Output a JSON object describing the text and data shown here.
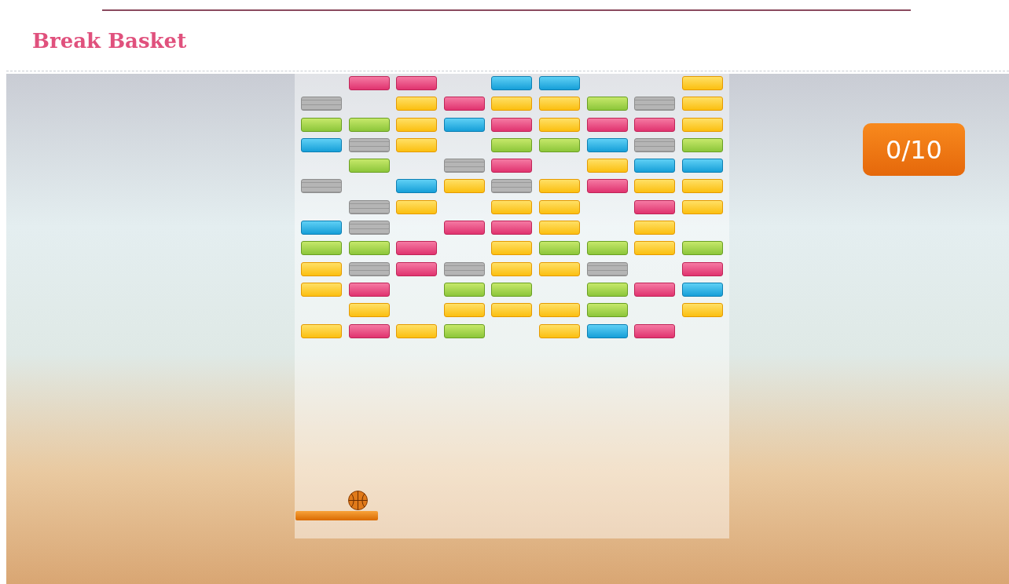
{
  "header": {
    "title": "Break Basket"
  },
  "game": {
    "score": "0/10",
    "brick_rows": [
      {
        "bricks": [
          {
            "kind": "empty"
          },
          {
            "kind": "pink"
          },
          {
            "kind": "pink"
          },
          {
            "kind": "empty"
          },
          {
            "kind": "blue"
          },
          {
            "kind": "blue"
          },
          {
            "kind": "empty"
          },
          {
            "kind": "empty"
          },
          {
            "kind": "yellow"
          }
        ]
      },
      {
        "bricks": [
          {
            "kind": "stone"
          },
          {
            "kind": "empty"
          },
          {
            "kind": "yellow"
          },
          {
            "kind": "pink"
          },
          {
            "kind": "yellow"
          },
          {
            "kind": "yellow"
          },
          {
            "kind": "green"
          },
          {
            "kind": "stone"
          },
          {
            "kind": "yellow"
          }
        ]
      },
      {
        "bricks": [
          {
            "kind": "green"
          },
          {
            "kind": "green"
          },
          {
            "kind": "yellow"
          },
          {
            "kind": "blue"
          },
          {
            "kind": "pink"
          },
          {
            "kind": "yellow"
          },
          {
            "kind": "pink"
          },
          {
            "kind": "pink"
          },
          {
            "kind": "yellow"
          }
        ]
      },
      {
        "bricks": [
          {
            "kind": "blue"
          },
          {
            "kind": "stone"
          },
          {
            "kind": "yellow"
          },
          {
            "kind": "empty"
          },
          {
            "kind": "green"
          },
          {
            "kind": "green"
          },
          {
            "kind": "blue"
          },
          {
            "kind": "stone"
          },
          {
            "kind": "green"
          }
        ]
      },
      {
        "bricks": [
          {
            "kind": "empty"
          },
          {
            "kind": "green"
          },
          {
            "kind": "empty"
          },
          {
            "kind": "stone"
          },
          {
            "kind": "pink"
          },
          {
            "kind": "empty"
          },
          {
            "kind": "yellow"
          },
          {
            "kind": "blue"
          },
          {
            "kind": "blue"
          }
        ]
      },
      {
        "bricks": [
          {
            "kind": "stone"
          },
          {
            "kind": "empty"
          },
          {
            "kind": "blue"
          },
          {
            "kind": "yellow"
          },
          {
            "kind": "stone"
          },
          {
            "kind": "yellow"
          },
          {
            "kind": "pink"
          },
          {
            "kind": "yellow"
          },
          {
            "kind": "yellow"
          }
        ]
      },
      {
        "bricks": [
          {
            "kind": "empty"
          },
          {
            "kind": "stone"
          },
          {
            "kind": "yellow"
          },
          {
            "kind": "empty"
          },
          {
            "kind": "yellow"
          },
          {
            "kind": "yellow"
          },
          {
            "kind": "empty"
          },
          {
            "kind": "pink"
          },
          {
            "kind": "yellow"
          }
        ]
      },
      {
        "bricks": [
          {
            "kind": "blue"
          },
          {
            "kind": "stone"
          },
          {
            "kind": "empty"
          },
          {
            "kind": "pink"
          },
          {
            "kind": "pink"
          },
          {
            "kind": "yellow"
          },
          {
            "kind": "empty"
          },
          {
            "kind": "yellow"
          },
          {
            "kind": "empty"
          }
        ]
      },
      {
        "bricks": [
          {
            "kind": "green"
          },
          {
            "kind": "green"
          },
          {
            "kind": "pink"
          },
          {
            "kind": "empty"
          },
          {
            "kind": "yellow"
          },
          {
            "kind": "green"
          },
          {
            "kind": "green"
          },
          {
            "kind": "yellow"
          },
          {
            "kind": "green"
          }
        ]
      },
      {
        "bricks": [
          {
            "kind": "yellow"
          },
          {
            "kind": "stone"
          },
          {
            "kind": "pink"
          },
          {
            "kind": "stone"
          },
          {
            "kind": "yellow"
          },
          {
            "kind": "yellow"
          },
          {
            "kind": "stone"
          },
          {
            "kind": "empty"
          },
          {
            "kind": "pink"
          }
        ]
      },
      {
        "bricks": [
          {
            "kind": "yellow"
          },
          {
            "kind": "pink"
          },
          {
            "kind": "empty"
          },
          {
            "kind": "green"
          },
          {
            "kind": "green"
          },
          {
            "kind": "empty"
          },
          {
            "kind": "green"
          },
          {
            "kind": "pink"
          },
          {
            "kind": "blue"
          }
        ]
      },
      {
        "bricks": [
          {
            "kind": "empty"
          },
          {
            "kind": "yellow"
          },
          {
            "kind": "empty"
          },
          {
            "kind": "yellow"
          },
          {
            "kind": "yellow"
          },
          {
            "kind": "yellow"
          },
          {
            "kind": "green"
          },
          {
            "kind": "empty"
          },
          {
            "kind": "yellow"
          }
        ]
      },
      {
        "bricks": [
          {
            "kind": "yellow"
          },
          {
            "kind": "pink"
          },
          {
            "kind": "yellow"
          },
          {
            "kind": "green"
          },
          {
            "kind": "empty"
          },
          {
            "kind": "yellow"
          },
          {
            "kind": "blue"
          },
          {
            "kind": "pink"
          },
          {
            "kind": "empty"
          }
        ]
      }
    ]
  }
}
